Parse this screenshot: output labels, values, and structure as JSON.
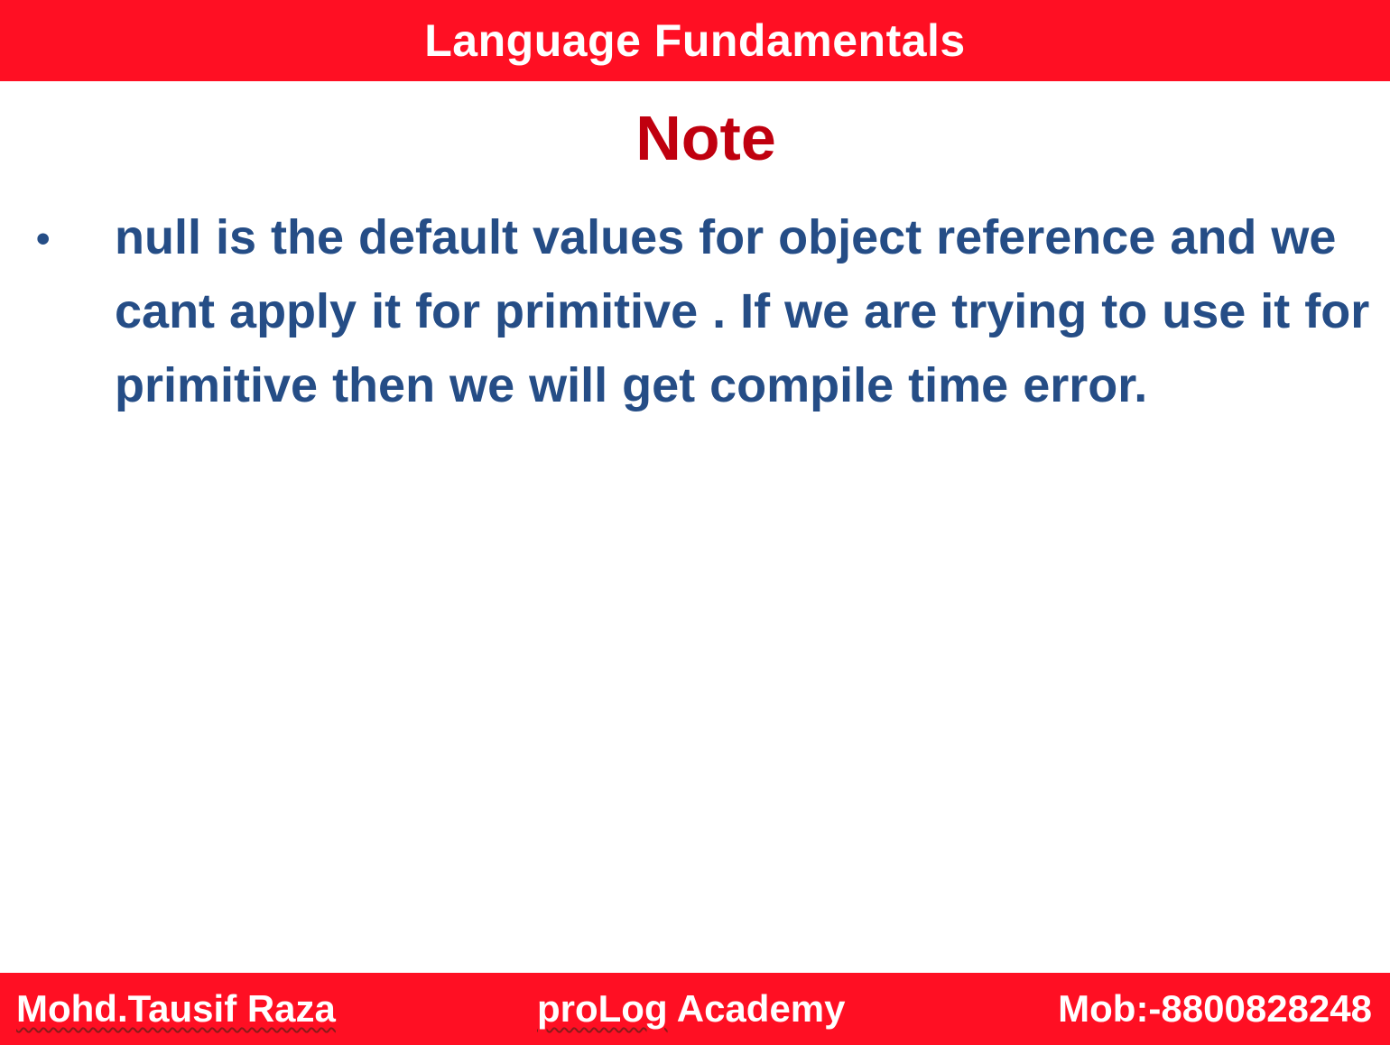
{
  "header": {
    "title": "Language Fundamentals"
  },
  "heading": "Note",
  "bullets": [
    {
      "text": "null is the default values for object reference and we cant apply it for primitive . If we are trying to use it for primitive then we will get compile time error."
    }
  ],
  "footer": {
    "author": "Mohd.Tausif Raza",
    "academy_prefix": "proLog",
    "academy_suffix": " Academy",
    "mobile": "Mob:-8800828248"
  },
  "colors": {
    "banner": "#ff0f23",
    "heading": "#c0000f",
    "body_text": "#254d86",
    "banner_text": "#ffffff"
  }
}
